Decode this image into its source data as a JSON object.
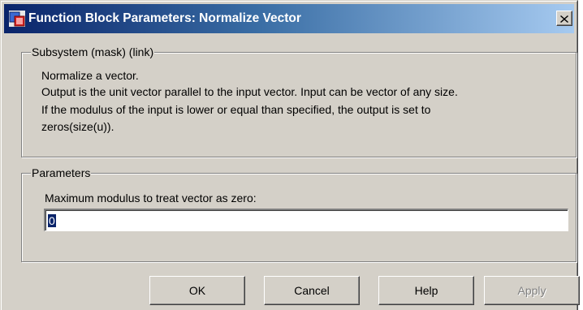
{
  "window": {
    "title": "Function Block Parameters: Normalize Vector",
    "close_label": "X"
  },
  "description_group": {
    "legend": "Subsystem (mask) (link)",
    "lines": [
      "Normalize a vector.",
      "Output is the unit vector parallel to the input vector. Input can be vector of any size.",
      "If the modulus of the input is lower or equal than specified, the output is set to",
      "zeros(size(u))."
    ]
  },
  "parameters_group": {
    "legend": "Parameters",
    "field_label": "Maximum modulus to treat vector as zero:",
    "field_value": "0"
  },
  "buttons": {
    "ok": "OK",
    "cancel": "Cancel",
    "help": "Help",
    "apply": "Apply"
  },
  "colors": {
    "title_start": "#0a246a",
    "title_end": "#a6caf0",
    "face": "#d4d0c8"
  }
}
